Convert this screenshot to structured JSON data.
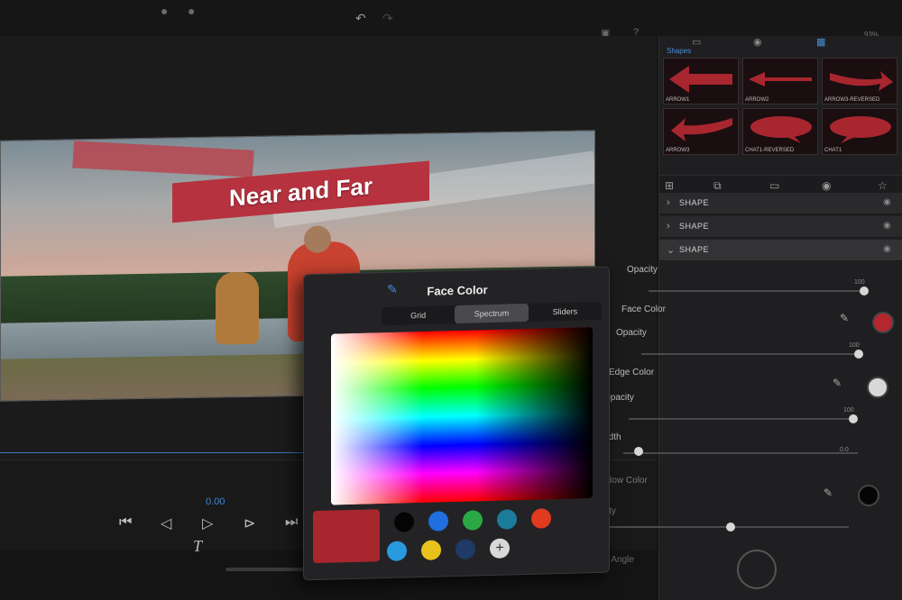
{
  "canvas": {
    "title_text": "Near and Far",
    "time": "0.00"
  },
  "right_panel": {
    "status": "93%",
    "shapes_header": "Shapes",
    "shapes": [
      {
        "caption": "ARROW1"
      },
      {
        "caption": "ARROW2"
      },
      {
        "caption": "ARROW3-REVERSED"
      },
      {
        "caption": "ARROW3"
      },
      {
        "caption": "CHAT1-REVERSED"
      },
      {
        "caption": "CHAT1"
      }
    ],
    "layers": [
      {
        "label": "SHAPE"
      },
      {
        "label": "SHAPE"
      },
      {
        "label": "SHAPE"
      }
    ],
    "props": {
      "opacity": "Opacity",
      "opacity_value": "100",
      "face_color": "Face Color",
      "face_opacity": "Opacity",
      "face_opacity_value": "100",
      "edge_color": "Edge Color",
      "edge_opacity": "Opacity",
      "edge_opacity_value": "100",
      "width": "Width",
      "width_value": "0.0",
      "shadow_color": "Shadow Color",
      "shadow_opacity": "Opacity",
      "shadow_angle": "Shadow Angle"
    }
  },
  "popover": {
    "title": "Face Color",
    "tabs": [
      {
        "label": "Grid"
      },
      {
        "label": "Spectrum"
      },
      {
        "label": "Sliders"
      }
    ],
    "current_color": "#a8262e",
    "swatches": [
      "#050505",
      "#1f6fe0",
      "#2aa845",
      "#1b7b9a",
      "#e03a1f",
      "#2a9ae0",
      "#e6c21a",
      "#1f3a66"
    ]
  },
  "icons": {
    "undo": "undo-icon",
    "redo": "redo-icon",
    "help": "help-icon",
    "eyedropper": "eyedropper-icon",
    "text_tool": "text-tool-icon"
  }
}
